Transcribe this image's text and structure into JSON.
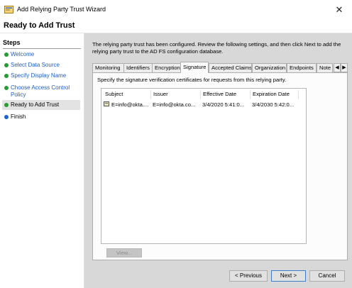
{
  "window": {
    "title": "Add Relying Party Trust Wizard",
    "close_glyph": "✕",
    "icon": "wizard-app-icon"
  },
  "header": {
    "heading": "Ready to Add Trust"
  },
  "steps": {
    "title": "Steps",
    "items": [
      {
        "label": "Welcome",
        "state": "done"
      },
      {
        "label": "Select Data Source",
        "state": "done"
      },
      {
        "label": "Specify Display Name",
        "state": "done"
      },
      {
        "label": "Choose Access Control Policy",
        "state": "done"
      },
      {
        "label": "Ready to Add Trust",
        "state": "current"
      },
      {
        "label": "Finish",
        "state": "pending"
      }
    ]
  },
  "main": {
    "description": "The relying party trust has been configured. Review the following settings, and then click Next to add the relying party trust to the AD FS configuration database.",
    "tabs": [
      {
        "label": "Monitoring"
      },
      {
        "label": "Identifiers"
      },
      {
        "label": "Encryption"
      },
      {
        "label": "Signature",
        "active": true
      },
      {
        "label": "Accepted Claims"
      },
      {
        "label": "Organization"
      },
      {
        "label": "Endpoints"
      },
      {
        "label": "Note"
      }
    ],
    "tab_scroll_left": "◀",
    "tab_scroll_right": "▶",
    "signature_panel": {
      "description": "Specify the signature verification certificates for requests from this relying party.",
      "columns": [
        "Subject",
        "Issuer",
        "Effective Date",
        "Expiration Date"
      ],
      "rows": [
        {
          "subject": "E=info@okta....",
          "issuer": "E=info@okta.co...",
          "effective_date": "3/4/2020 5:41:0...",
          "expiration_date": "3/4/2030 5:42:0..."
        }
      ],
      "view_button": "View..."
    }
  },
  "footer": {
    "previous_label": "< Previous",
    "next_label": "Next >",
    "cancel_label": "Cancel"
  },
  "colors": {
    "step_link": "#1f5fbf",
    "step_done_dot": "#2a9a33",
    "step_pending_dot": "#1e63c9",
    "default_button_border": "#3c7fd1"
  }
}
